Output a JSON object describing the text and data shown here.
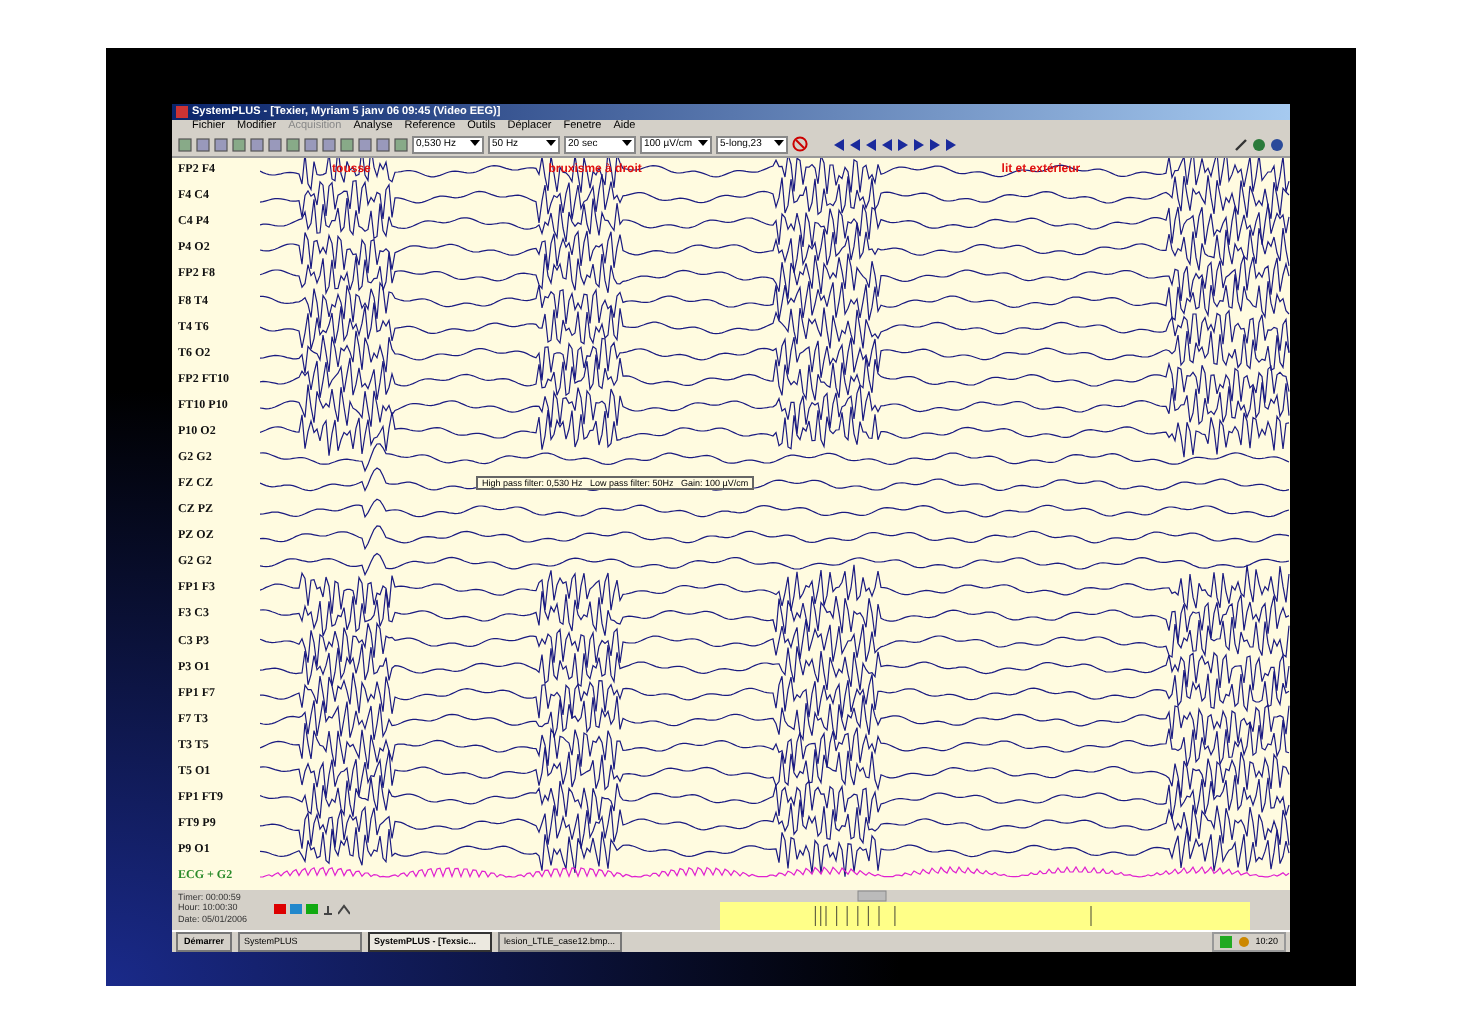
{
  "window": {
    "title": "SystemPLUS - [Texier, Myriam 5 janv 06 09:45 (Video EEG)]"
  },
  "menu": [
    {
      "label": "Fichier",
      "disabled": false
    },
    {
      "label": "Modifier",
      "disabled": false
    },
    {
      "label": "Acquisition",
      "disabled": true
    },
    {
      "label": "Analyse",
      "disabled": false
    },
    {
      "label": "Reference",
      "disabled": false
    },
    {
      "label": "Outils",
      "disabled": false
    },
    {
      "label": "Déplacer",
      "disabled": false
    },
    {
      "label": "Fenetre",
      "disabled": false
    },
    {
      "label": "Aide",
      "disabled": false
    }
  ],
  "toolbar": {
    "dropdowns": [
      "0,530 Hz",
      "50 Hz",
      "20 sec",
      "100 µV/cm",
      "5-long,23"
    ]
  },
  "channels": [
    "FP2 F4",
    "F4 C4",
    "C4 P4",
    "P4 O2",
    "FP2 F8",
    "F8 T4",
    "T4 T6",
    "T6 O2",
    "FP2 FT10",
    "FT10 P10",
    "P10 O2",
    "G2 G2",
    "FZ CZ",
    "CZ PZ",
    "PZ OZ",
    "G2 G2",
    "FP1 F3",
    "F3 C3",
    "C3 P3",
    "P3 O1",
    "FP1 F7",
    "F7 T3",
    "T3 T5",
    "T5 O1",
    "FP1 FT9",
    "FT9 P9",
    "P9 O1",
    "ECG + G2"
  ],
  "annotations": [
    "tousse",
    "bruxisme à droit",
    "lit et extérieur"
  ],
  "filter_label": "High pass filter: 0,530 Hz   Low pass filter: 50Hz   Gain: 100 µV/cm",
  "status": {
    "timer": "Timer: 00:00:59",
    "hour": "Hour: 10:00:30",
    "date": "Date: 05/01/2006"
  },
  "taskbar": {
    "start": "Démarrer",
    "tasks": [
      {
        "label": "SystemPLUS",
        "selected": false
      },
      {
        "label": "SystemPLUS - [Texsic...",
        "selected": true
      },
      {
        "label": "lesion_LTLE_case12.bmp...",
        "selected": false
      }
    ],
    "clock": "10:20"
  }
}
